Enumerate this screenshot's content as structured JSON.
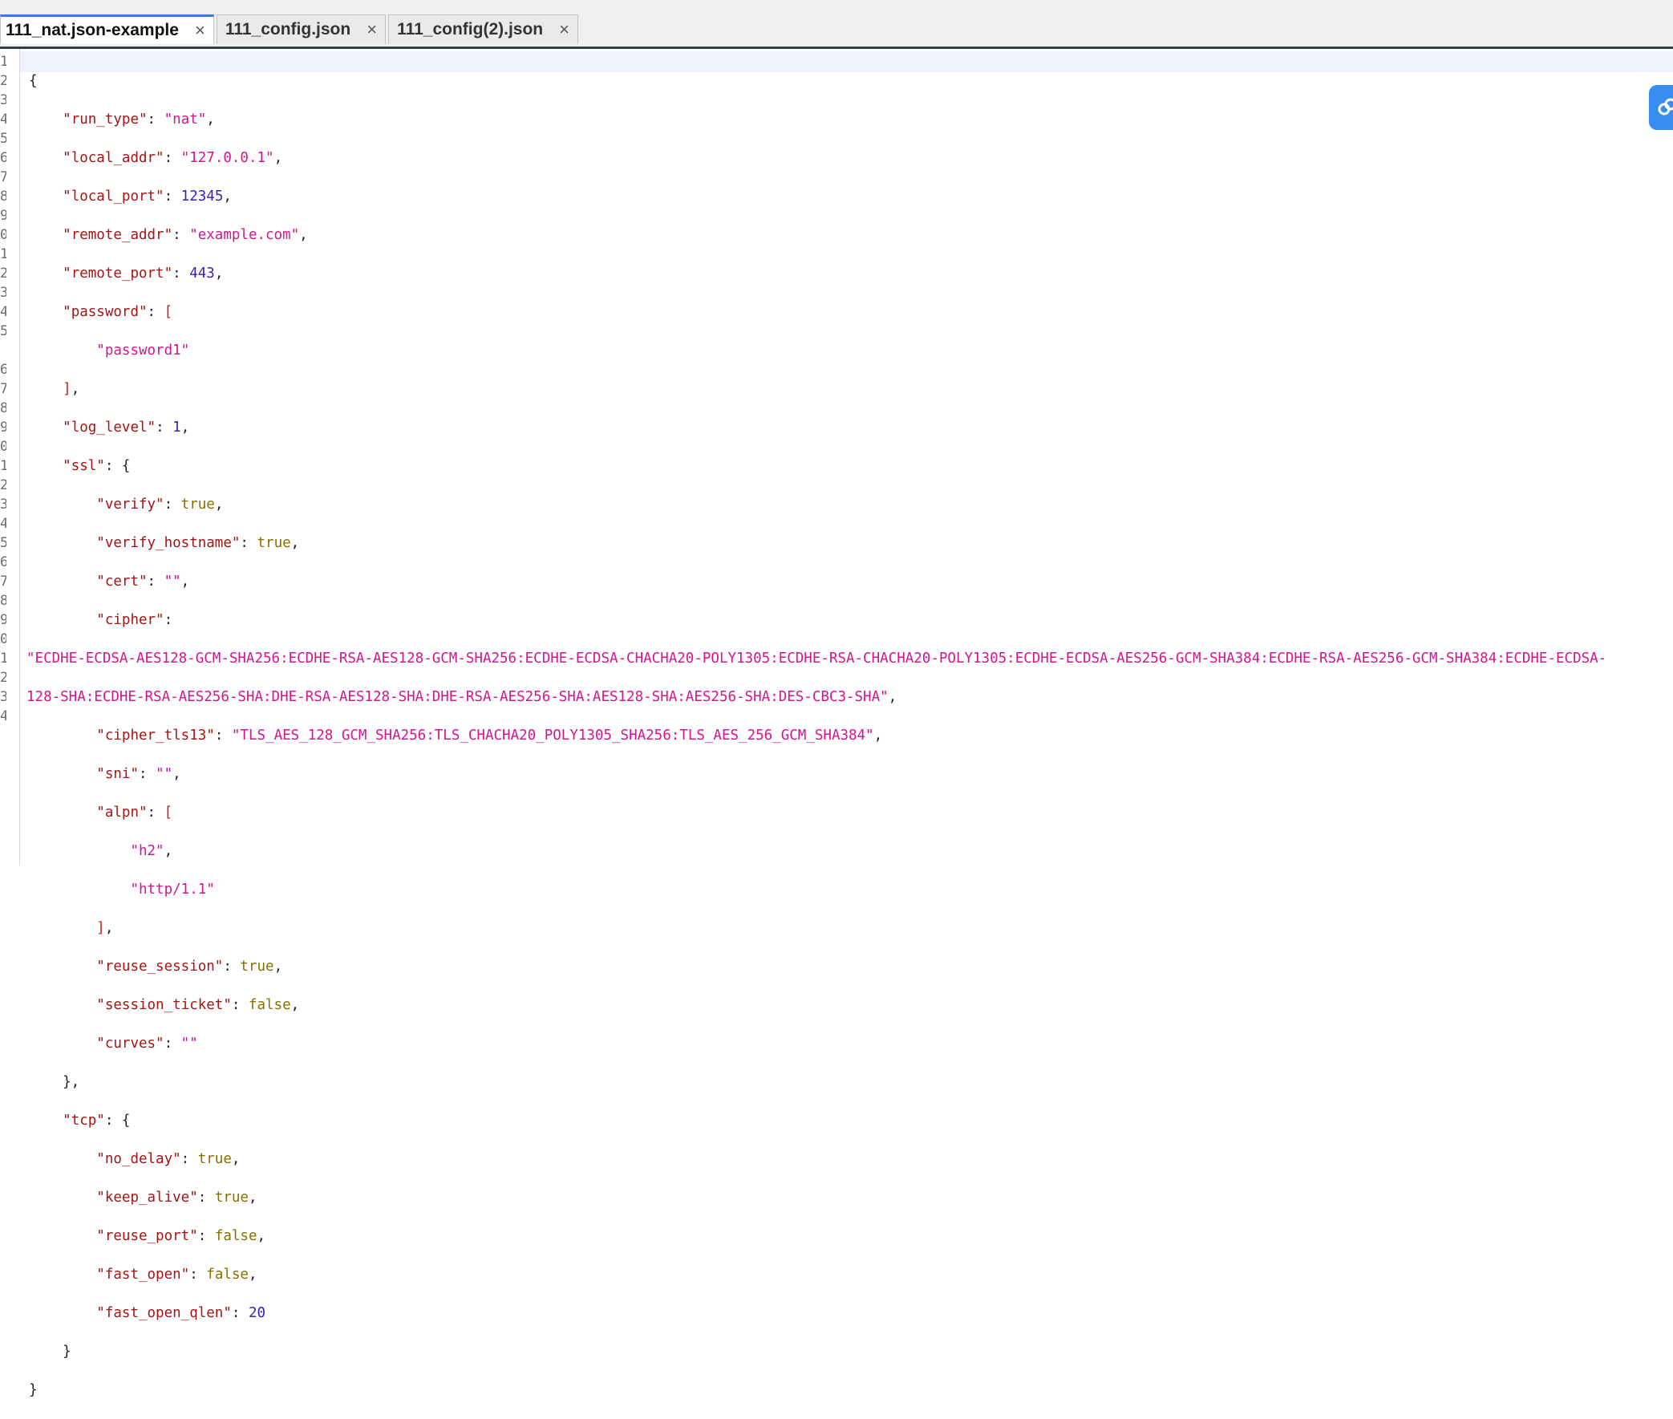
{
  "tabs": [
    {
      "label": "111_nat.json-example",
      "active": true
    },
    {
      "label": "111_config.json",
      "active": false
    },
    {
      "label": "111_config(2).json",
      "active": false
    }
  ],
  "close_glyph": "×",
  "float_button_icon": "link-icon",
  "line_numbers": [
    "1",
    "2",
    "3",
    "4",
    "5",
    "6",
    "7",
    "8",
    "9",
    "0",
    "1",
    "2",
    "3",
    "4",
    "5",
    "",
    "6",
    "7",
    "8",
    "9",
    "0",
    "1",
    "2",
    "3",
    "4",
    "5",
    "6",
    "7",
    "8",
    "9",
    "0",
    "1",
    "2",
    "3",
    "4"
  ],
  "code": {
    "l1": "{",
    "l2_key": "\"run_type\"",
    "l2_val": "\"nat\"",
    "l3_key": "\"local_addr\"",
    "l3_val": "\"127.0.0.1\"",
    "l4_key": "\"local_port\"",
    "l4_val": "12345",
    "l5_key": "\"remote_addr\"",
    "l5_val": "\"example.com\"",
    "l6_key": "\"remote_port\"",
    "l6_val": "443",
    "l7_key": "\"password\"",
    "l8_val": "\"password1\"",
    "l10_key": "\"log_level\"",
    "l10_val": "1",
    "l11_key": "\"ssl\"",
    "l12_key": "\"verify\"",
    "l12_val": "true",
    "l13_key": "\"verify_hostname\"",
    "l13_val": "true",
    "l14_key": "\"cert\"",
    "l14_val": "\"\"",
    "l15_key": "\"cipher\"",
    "l15_wrap1": "\"ECDHE-ECDSA-AES128-GCM-SHA256:ECDHE-RSA-AES128-GCM-SHA256:ECDHE-ECDSA-CHACHA20-POLY1305:ECDHE-RSA-CHACHA20-POLY1305:ECDHE-ECDSA-AES256-GCM-SHA384:ECDHE-RSA-AES256-GCM-SHA384:ECDHE-ECDSA-",
    "l15_wrap2": "128-SHA:ECDHE-RSA-AES256-SHA:DHE-RSA-AES128-SHA:DHE-RSA-AES256-SHA:AES128-SHA:AES256-SHA:DES-CBC3-SHA\"",
    "l16_key": "\"cipher_tls13\"",
    "l16_val": "\"TLS_AES_128_GCM_SHA256:TLS_CHACHA20_POLY1305_SHA256:TLS_AES_256_GCM_SHA384\"",
    "l17_key": "\"sni\"",
    "l17_val": "\"\"",
    "l18_key": "\"alpn\"",
    "l19_val": "\"h2\"",
    "l20_val": "\"http/1.1\"",
    "l22_key": "\"reuse_session\"",
    "l22_val": "true",
    "l23_key": "\"session_ticket\"",
    "l23_val": "false",
    "l24_key": "\"curves\"",
    "l24_val": "\"\"",
    "l26_key": "\"tcp\"",
    "l27_key": "\"no_delay\"",
    "l27_val": "true",
    "l28_key": "\"keep_alive\"",
    "l28_val": "true",
    "l29_key": "\"reuse_port\"",
    "l29_val": "false",
    "l30_key": "\"fast_open\"",
    "l30_val": "false",
    "l31_key": "\"fast_open_qlen\"",
    "l31_val": "20"
  },
  "colors": {
    "accent": "#3b7ad9",
    "key": "#a31515",
    "string": "#d1168f",
    "number": "#3c1cb5",
    "boolean": "#8a6d00",
    "float_button": "#3a8df0"
  }
}
